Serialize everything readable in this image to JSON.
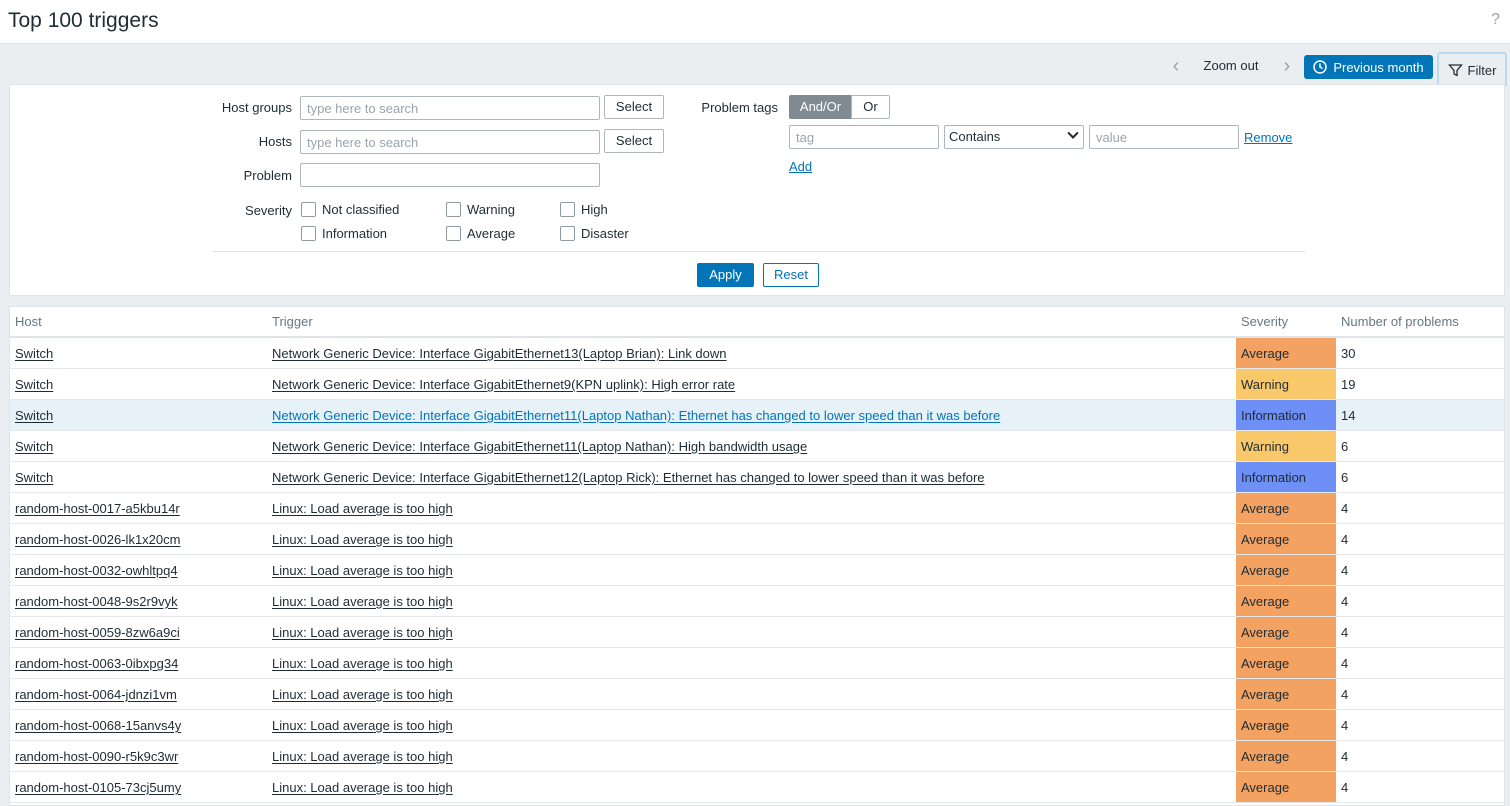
{
  "header": {
    "title": "Top 100 triggers",
    "help": "?"
  },
  "toolbar": {
    "zoom_out": "Zoom out",
    "previous_month": "Previous month",
    "filter": "Filter"
  },
  "filter": {
    "host_groups_label": "Host groups",
    "hosts_label": "Hosts",
    "problem_label": "Problem",
    "severity_label": "Severity",
    "search_placeholder": "type here to search",
    "problem_value": "",
    "select_label": "Select",
    "problem_tags_label": "Problem tags",
    "tags_andor": "And/Or",
    "tags_or": "Or",
    "tag_placeholder": "tag",
    "operator": "Contains",
    "value_placeholder": "value",
    "remove": "Remove",
    "add": "Add",
    "severities": {
      "not_classified": "Not classified",
      "information": "Information",
      "warning": "Warning",
      "average": "Average",
      "high": "High",
      "disaster": "Disaster"
    },
    "apply": "Apply",
    "reset": "Reset"
  },
  "colors": {
    "Average": "#f4a261",
    "Warning": "#f9c86b",
    "Information": "#6d8ff6",
    "accent": "#0275b8"
  },
  "table": {
    "columns": [
      "Host",
      "Trigger",
      "Severity",
      "Number of problems"
    ],
    "rows": [
      {
        "host": "Switch",
        "trigger": "Network Generic Device: Interface GigabitEthernet13(Laptop Brian): Link down",
        "severity": "Average",
        "count": "30"
      },
      {
        "host": "Switch",
        "trigger": "Network Generic Device: Interface GigabitEthernet9(KPN uplink): High error rate",
        "severity": "Warning",
        "count": "19"
      },
      {
        "host": "Switch",
        "trigger": "Network Generic Device: Interface GigabitEthernet11(Laptop Nathan): Ethernet has changed to lower speed than it was before",
        "severity": "Information",
        "count": "14",
        "highlight": true
      },
      {
        "host": "Switch",
        "trigger": "Network Generic Device: Interface GigabitEthernet11(Laptop Nathan): High bandwidth usage",
        "severity": "Warning",
        "count": "6"
      },
      {
        "host": "Switch",
        "trigger": "Network Generic Device: Interface GigabitEthernet12(Laptop Rick): Ethernet has changed to lower speed than it was before",
        "severity": "Information",
        "count": "6"
      },
      {
        "host": "random-host-0017-a5kbu14r",
        "trigger": "Linux: Load average is too high",
        "severity": "Average",
        "count": "4"
      },
      {
        "host": "random-host-0026-lk1x20cm",
        "trigger": "Linux: Load average is too high",
        "severity": "Average",
        "count": "4"
      },
      {
        "host": "random-host-0032-owhltpq4",
        "trigger": "Linux: Load average is too high",
        "severity": "Average",
        "count": "4"
      },
      {
        "host": "random-host-0048-9s2r9vyk",
        "trigger": "Linux: Load average is too high",
        "severity": "Average",
        "count": "4"
      },
      {
        "host": "random-host-0059-8zw6a9ci",
        "trigger": "Linux: Load average is too high",
        "severity": "Average",
        "count": "4"
      },
      {
        "host": "random-host-0063-0ibxpg34",
        "trigger": "Linux: Load average is too high",
        "severity": "Average",
        "count": "4"
      },
      {
        "host": "random-host-0064-jdnzi1vm",
        "trigger": "Linux: Load average is too high",
        "severity": "Average",
        "count": "4"
      },
      {
        "host": "random-host-0068-15anvs4y",
        "trigger": "Linux: Load average is too high",
        "severity": "Average",
        "count": "4"
      },
      {
        "host": "random-host-0090-r5k9c3wr",
        "trigger": "Linux: Load average is too high",
        "severity": "Average",
        "count": "4"
      },
      {
        "host": "random-host-0105-73cj5umy",
        "trigger": "Linux: Load average is too high",
        "severity": "Average",
        "count": "4"
      }
    ]
  }
}
